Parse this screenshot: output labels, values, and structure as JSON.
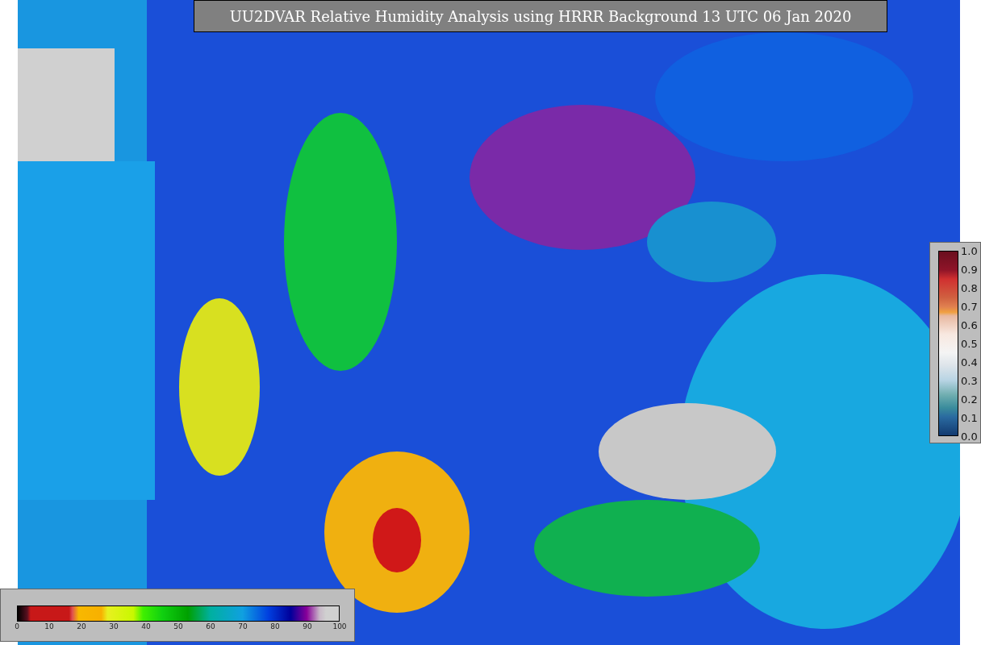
{
  "title": "UU2DVAR Relative Humidity Analysis using HRRR Background 13 UTC 06 Jan 2020",
  "humidity_colorbar": {
    "ticks": [
      "0",
      "10",
      "20",
      "30",
      "40",
      "50",
      "60",
      "70",
      "80",
      "90",
      "100"
    ]
  },
  "observation_colorbar": {
    "ticks": [
      "1.0",
      "0.9",
      "0.8",
      "0.7",
      "0.6",
      "0.5",
      "0.4",
      "0.3",
      "0.2",
      "0.1",
      "0.0"
    ]
  }
}
